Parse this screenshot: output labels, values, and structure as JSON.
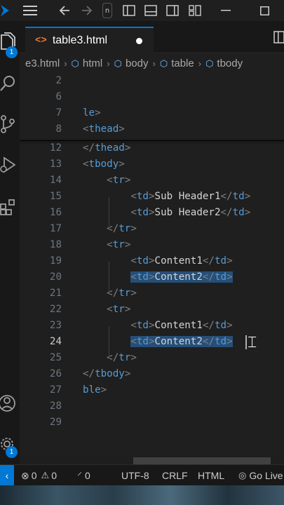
{
  "titlebar": {
    "icons": [
      "vscode-logo",
      "menu",
      "back",
      "forward",
      "search",
      "toggle-primary-sidebar",
      "toggle-panel",
      "toggle-secondary-sidebar",
      "customize-layout",
      "minimize",
      "maximize"
    ]
  },
  "activity_bar": {
    "explorer_badge": "1",
    "settings_badge": "1"
  },
  "tab": {
    "label": "table3.html",
    "modified": true
  },
  "breadcrumb": {
    "items": [
      "e3.html",
      "html",
      "body",
      "table",
      "tbody"
    ]
  },
  "editor": {
    "sticky_lines": [
      {
        "num": "2",
        "text": ""
      },
      {
        "num": "6",
        "text": ""
      },
      {
        "num": "7",
        "text": "le>"
      },
      {
        "num": "8",
        "text": "<thead>"
      }
    ],
    "lines": [
      {
        "num": "12",
        "text": "</thead>"
      },
      {
        "num": "13",
        "text": "<tbody>"
      },
      {
        "num": "14",
        "text": "    <tr>"
      },
      {
        "num": "15",
        "text": "        <td>Sub Header1</td>"
      },
      {
        "num": "16",
        "text": "        <td>Sub Header2</td>"
      },
      {
        "num": "17",
        "text": "    </tr>"
      },
      {
        "num": "18",
        "text": "    <tr>"
      },
      {
        "num": "19",
        "text": "        <td>Content1</td>"
      },
      {
        "num": "20",
        "text": "        <td>Content2</td>"
      },
      {
        "num": "21",
        "text": "    </tr>"
      },
      {
        "num": "22",
        "text": "    <tr>"
      },
      {
        "num": "23",
        "text": "        <td>Content1</td>"
      },
      {
        "num": "24",
        "text": "        <td>Content2</td>"
      },
      {
        "num": "25",
        "text": "    </tr>"
      },
      {
        "num": "26",
        "text": "</tbody>"
      },
      {
        "num": "27",
        "text": "ble>"
      },
      {
        "num": "28",
        "text": ""
      },
      {
        "num": "29",
        "text": ""
      }
    ],
    "active_line": "24"
  },
  "statusbar": {
    "errors": "0",
    "warnings": "0",
    "ports": "0",
    "encoding": "UTF-8",
    "eol": "CRLF",
    "language": "HTML",
    "go_live": "Go Live"
  },
  "colors": {
    "accent": "#0078d4",
    "tag": "#569cd6",
    "selection": "#264f78",
    "html_icon": "#e37933"
  }
}
